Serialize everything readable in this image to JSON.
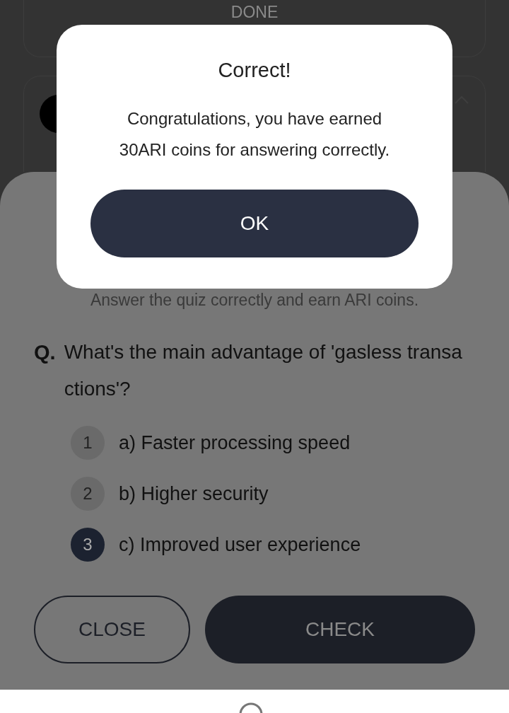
{
  "background": {
    "done_button": "DONE"
  },
  "quiz": {
    "subtitle": "Answer the quiz correctly and earn ARI coins.",
    "question_mark": "Q.",
    "question": "What's the main advantage of 'gasless transactions'?",
    "options": [
      {
        "number": "1",
        "text": "a) Faster processing speed",
        "selected": false
      },
      {
        "number": "2",
        "text": "b) Higher security",
        "selected": false
      },
      {
        "number": "3",
        "text": "c) Improved user experience",
        "selected": true
      }
    ],
    "buttons": {
      "close": "CLOSE",
      "check": "CHECK"
    }
  },
  "dialog": {
    "title": "Correct!",
    "message": "Congratulations, you have earned 30ARI coins for answering correctly.",
    "ok": "OK"
  }
}
